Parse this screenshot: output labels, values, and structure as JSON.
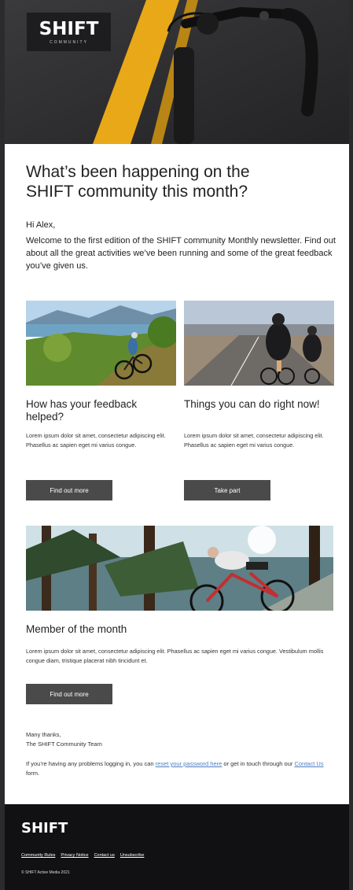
{
  "brand": {
    "logo": "SHIFT",
    "logo_sub": "COMMUNITY"
  },
  "intro": {
    "headline_line1": "What’s been happening on the",
    "headline_line2": "SHIFT community this month?",
    "greeting": "Hi Alex,",
    "body": "Welcome to the first edition of the SHIFT community Monthly newsletter. Find out about all the great activities we’ve been running and some of the great feedback you’ve given us."
  },
  "cards": [
    {
      "title": "How has your feedback helped?",
      "body": "Lorem ipsum dolor sit amet, consectetur adipiscing elit. Phasellus ac sapien eget mi varius congue.",
      "button": "Find out more"
    },
    {
      "title": "Things you can do right now!",
      "body": "Lorem ipsum dolor sit amet, consectetur adipiscing elit. Phasellus ac sapien eget mi varius congue.",
      "button": "Take part"
    }
  ],
  "member": {
    "title": "Member of the month",
    "body": "Lorem ipsum dolor sit amet, consectetur adipiscing elit. Phasellus ac sapien eget mi varius congue. Vestibulum mollis congue diam, tristique placerat nibh tincidunt et.",
    "button": "Find out more"
  },
  "signoff": {
    "line1": "Many thanks,",
    "line2": "The SHIFT Community Team"
  },
  "problem": {
    "before": "If you’re having any problems logging in, you can ",
    "link1": "reset your password here",
    "middle": " or get in touch through our ",
    "link2": "Contact Us",
    "after": " form."
  },
  "footer": {
    "logo": "SHIFT",
    "links": [
      "Community Rules",
      "Privacy Notice",
      "Contact us",
      "Unsubscribe"
    ],
    "copyright": "© SHIFT Active Media 2021"
  },
  "colors": {
    "button_bg": "#4a4a4a",
    "footer_bg": "#111113",
    "link": "#4f7ec2",
    "road_line": "#e8a818"
  }
}
